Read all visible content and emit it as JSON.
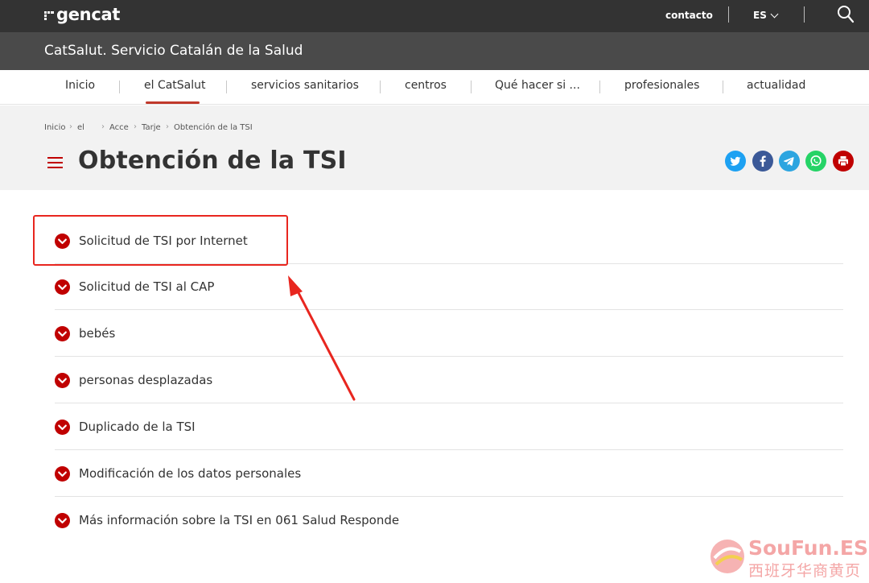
{
  "topbar": {
    "logo_text": "gencat",
    "contact_label": "contacto",
    "language_label": "ES"
  },
  "site": {
    "title": "CatSalut. Servicio Catalán de la Salud"
  },
  "nav": {
    "items": [
      {
        "label": "Inicio"
      },
      {
        "label": "el CatSalut"
      },
      {
        "label": "servicios sanitarios"
      },
      {
        "label": "centros"
      },
      {
        "label": "Qué hacer si ..."
      },
      {
        "label": "profesionales"
      },
      {
        "label": "actualidad"
      }
    ],
    "active": "el CatSalut"
  },
  "breadcrumb": {
    "items": [
      "Inicio",
      "el",
      "Acce",
      "Tarje",
      "Obtención de la TSI"
    ]
  },
  "page": {
    "title": "Obtención de la TSI"
  },
  "share": {
    "icons": [
      "twitter-icon",
      "facebook-icon",
      "telegram-icon",
      "whatsapp-icon",
      "print-icon"
    ],
    "colors": {
      "twitter": "#1da1f2",
      "facebook": "#3b5998",
      "telegram": "#2ca5e0",
      "whatsapp": "#25d366",
      "print": "#c00000"
    }
  },
  "accordion": {
    "items": [
      {
        "label": "Solicitud de TSI por Internet"
      },
      {
        "label": "Solicitud de TSI al CAP"
      },
      {
        "label": "bebés"
      },
      {
        "label": "personas desplazadas"
      },
      {
        "label": "Duplicado de la TSI"
      },
      {
        "label": "Modificación de los datos personales"
      },
      {
        "label": "Más información sobre la TSI en 061 Salud Responde"
      }
    ],
    "icon_color": "#c00000"
  },
  "annotation": {
    "color": "#e8261f"
  },
  "watermark": {
    "brand": "SouFun.ES",
    "subtitle": "西班牙华商黄页"
  }
}
